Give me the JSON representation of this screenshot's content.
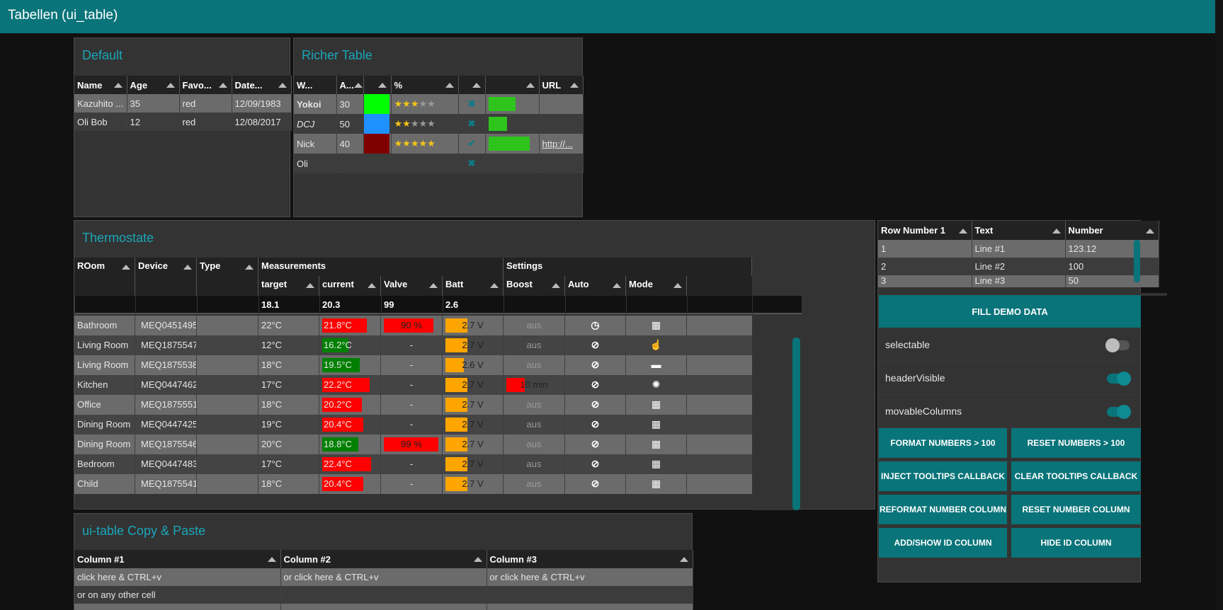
{
  "app": {
    "title": "Tabellen (ui_table)"
  },
  "colors": {
    "accent": "#097479",
    "title": "#1aa6b8",
    "red": "#ff0000",
    "green": "#008000",
    "orange": "#ffa500"
  },
  "default_table": {
    "title": "Default",
    "headers": [
      "Name",
      "Age",
      "Favo...",
      "Date..."
    ],
    "rows": [
      [
        "Kazuhito ...",
        "35",
        "red",
        "12/09/1983"
      ],
      [
        "Oli Bob",
        "12",
        "red",
        "12/08/2017"
      ]
    ]
  },
  "richer_table": {
    "title": "Richer Table",
    "headers": [
      "W...",
      "A...",
      "",
      "%",
      "",
      "",
      "URL"
    ],
    "rows": [
      {
        "name": "Yokoi",
        "age": "30",
        "color": "#00ff00",
        "stars": 3,
        "check": "x",
        "progress": 0.6,
        "url": ""
      },
      {
        "name": "DCJ",
        "age": "50",
        "color": "#1e90ff",
        "stars": 2,
        "check": "x",
        "progress": 0.4,
        "url": ""
      },
      {
        "name": "Nick",
        "age": "40",
        "color": "#800000",
        "stars": 5,
        "check": "check",
        "progress": 0.9,
        "url": "http://..."
      },
      {
        "name": "Oli",
        "age": "",
        "color": "",
        "stars": 0,
        "check": "x",
        "progress": 0,
        "url": ""
      }
    ]
  },
  "thermostate": {
    "title": "Thermostate",
    "group_headers": {
      "room": "ROom",
      "device": "Device",
      "type": "Type",
      "measurements": "Measurements",
      "settings": "Settings"
    },
    "sub_headers": [
      "target",
      "current",
      "Valve",
      "Batt",
      "Boost",
      "Auto",
      "Mode"
    ],
    "calc_row": [
      "18.1",
      "20.3",
      "99",
      "2.6"
    ],
    "rows": [
      {
        "room": "Bathroom",
        "device": "MEQ0451495",
        "target": "22°C",
        "current": "21.8°C",
        "current_color": "red",
        "current_level": 0.72,
        "valve": "90 %",
        "valve_level": 0.9,
        "batt": "2.7 V",
        "batt_level": 0.35,
        "boost": "aus",
        "boost_level": 0,
        "auto": "clock-icon",
        "mode": "calendar-icon"
      },
      {
        "room": "Living Room",
        "device": "MEQ1875547",
        "target": "12°C",
        "current": "16.2°C",
        "current_color": "green",
        "current_level": 0.42,
        "valve": "-",
        "valve_level": 0,
        "batt": "2.7 V",
        "batt_level": 0.35,
        "boost": "aus",
        "boost_level": 0,
        "auto": "ban-icon",
        "mode": "hand-icon"
      },
      {
        "room": "Living Room",
        "device": "MEQ1875538",
        "target": "18°C",
        "current": "19.5°C",
        "current_color": "green",
        "current_level": 0.6,
        "valve": "-",
        "valve_level": 0,
        "batt": "2.6 V",
        "batt_level": 0.3,
        "boost": "aus",
        "boost_level": 0,
        "auto": "ban-icon",
        "mode": "suitcase-icon"
      },
      {
        "room": "Kitchen",
        "device": "MEQ0447462",
        "target": "17°C",
        "current": "22.2°C",
        "current_color": "red",
        "current_level": 0.76,
        "valve": "-",
        "valve_level": 0,
        "batt": "2.7 V",
        "batt_level": 0.35,
        "boost": "10 min",
        "boost_level": 0.3,
        "auto": "ban-icon",
        "mode": "spinner-icon"
      },
      {
        "room": "Office",
        "device": "MEQ1875551",
        "target": "18°C",
        "current": "20.2°C",
        "current_color": "red",
        "current_level": 0.64,
        "valve": "-",
        "valve_level": 0,
        "batt": "2.7 V",
        "batt_level": 0.35,
        "boost": "aus",
        "boost_level": 0,
        "auto": "ban-icon",
        "mode": "calendar-icon"
      },
      {
        "room": "Dining Room",
        "device": "MEQ0447425",
        "target": "19°C",
        "current": "20.4°C",
        "current_color": "red",
        "current_level": 0.66,
        "valve": "-",
        "valve_level": 0,
        "batt": "2.7 V",
        "batt_level": 0.35,
        "boost": "aus",
        "boost_level": 0,
        "auto": "ban-icon",
        "mode": "calendar-icon"
      },
      {
        "room": "Dining Room",
        "device": "MEQ1875546",
        "target": "20°C",
        "current": "18.8°C",
        "current_color": "green",
        "current_level": 0.58,
        "valve": "99 %",
        "valve_level": 0.99,
        "batt": "2.7 V",
        "batt_level": 0.35,
        "boost": "aus",
        "boost_level": 0,
        "auto": "ban-icon",
        "mode": "calendar-icon"
      },
      {
        "room": "Bedroom",
        "device": "MEQ0447483",
        "target": "17°C",
        "current": "22.4°C",
        "current_color": "red",
        "current_level": 0.78,
        "valve": "-",
        "valve_level": 0,
        "batt": "2.7 V",
        "batt_level": 0.35,
        "boost": "aus",
        "boost_level": 0,
        "auto": "ban-icon",
        "mode": "calendar-icon"
      },
      {
        "room": "Child",
        "device": "MEQ1875541",
        "target": "18°C",
        "current": "20.4°C",
        "current_color": "red",
        "current_level": 0.66,
        "valve": "-",
        "valve_level": 0,
        "batt": "2.7 V",
        "batt_level": 0.35,
        "boost": "aus",
        "boost_level": 0,
        "auto": "ban-icon",
        "mode": "calendar-icon"
      }
    ]
  },
  "copy_paste": {
    "title": "ui-table Copy & Paste",
    "headers": [
      "Column #1",
      "Column #2",
      "Column #3"
    ],
    "rows": [
      [
        "click here & CTRL+v",
        "or click here & CTRL+v",
        "or click here & CTRL+v"
      ],
      [
        "or on any other cell",
        "",
        ""
      ]
    ]
  },
  "side_table": {
    "headers": [
      "Row Number 1",
      "Text",
      "Number"
    ],
    "rows": [
      [
        "1",
        "Line #1",
        "123.12"
      ],
      [
        "2",
        "Line #2",
        "100"
      ],
      [
        "3",
        "Line #3",
        "50"
      ]
    ]
  },
  "controls": {
    "fill_demo": "FILL DEMO DATA",
    "toggles": [
      {
        "label": "selectable",
        "on": false
      },
      {
        "label": "headerVisible",
        "on": true
      },
      {
        "label": "movableColumns",
        "on": true
      }
    ],
    "buttons": [
      [
        "FORMAT NUMBERS > 100",
        "RESET NUMBERS > 100"
      ],
      [
        "INJECT TOOLTIPS CALLBACK",
        "CLEAR TOOLTIPS CALLBACK"
      ],
      [
        "REFORMAT NUMBER COLUMN",
        "RESET NUMBER COLUMN"
      ],
      [
        "ADD/SHOW ID COLUMN",
        "HIDE ID COLUMN"
      ]
    ]
  }
}
